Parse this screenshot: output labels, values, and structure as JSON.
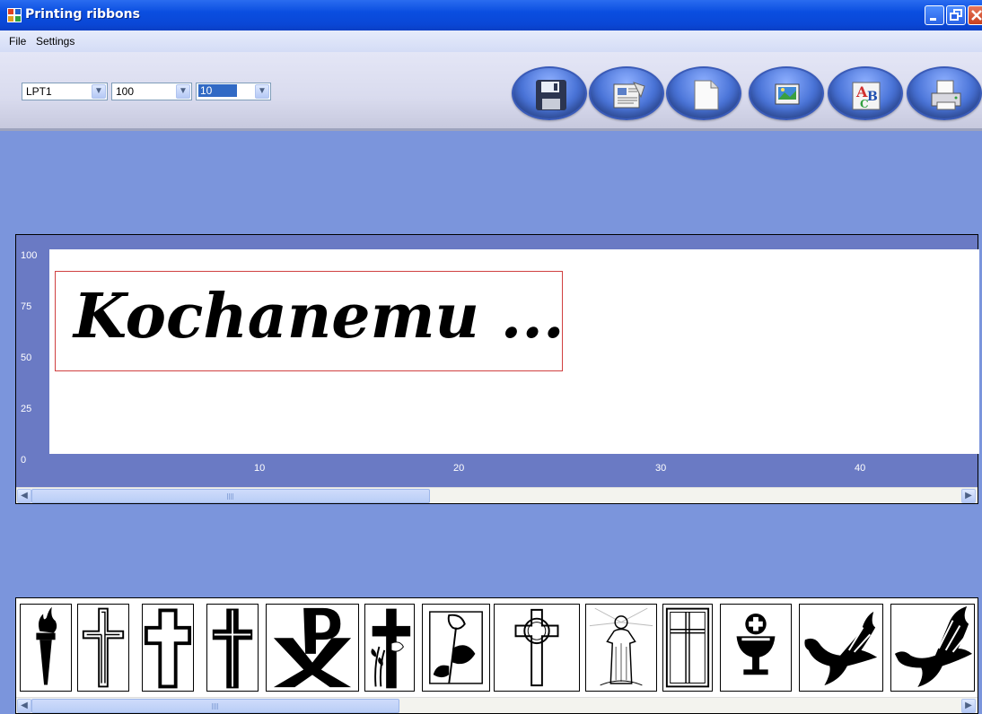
{
  "window": {
    "title": "Printing ribbons"
  },
  "menu": {
    "file": "File",
    "settings": "Settings"
  },
  "toolbar": {
    "port": "LPT1",
    "ribbon_height": "100",
    "font_size": "10",
    "buttons": [
      "save-icon",
      "open-icon",
      "new-page-icon",
      "image-icon",
      "font-icon",
      "print-icon"
    ]
  },
  "preview": {
    "text": "Kochanemu ...",
    "y_ticks": [
      "100",
      "75",
      "50",
      "25",
      "0"
    ],
    "x_ticks": [
      "10",
      "20",
      "30",
      "40"
    ],
    "text_box_color": "#d04040",
    "panel_color": "#6a7ac4"
  },
  "gallery": {
    "symbols": [
      "torch-icon",
      "double-outline-cross-icon",
      "outline-cross-icon",
      "double-line-cross-icon",
      "chi-rho-icon",
      "cross-with-lily-icon",
      "calla-lily-icon",
      "celtic-cross-icon",
      "jesus-figure-icon",
      "framed-cross-icon",
      "chalice-icon",
      "dove-icon",
      "dove-large-icon"
    ]
  },
  "colors": {
    "background": "#7b95dc",
    "titlebar": "#0a4ee0"
  }
}
